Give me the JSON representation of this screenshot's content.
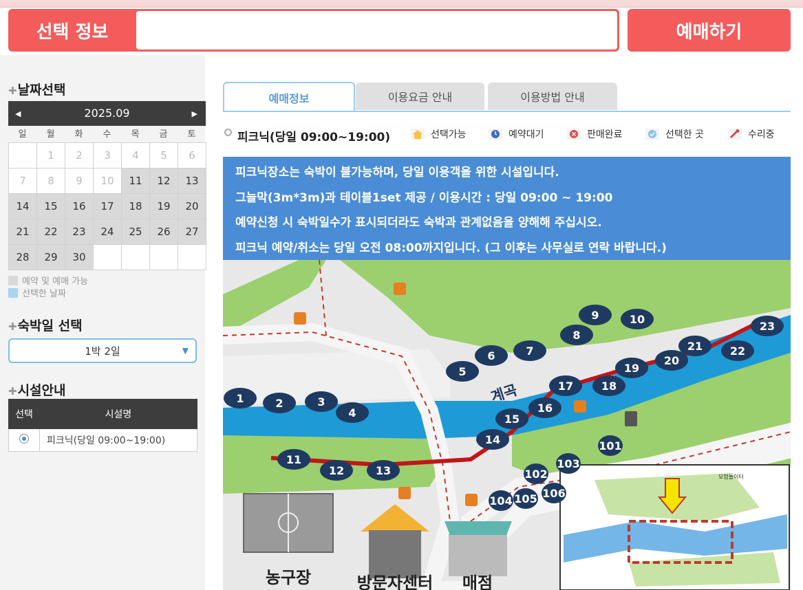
{
  "header": {
    "selection_label": "선택 정보",
    "selection_value": "",
    "book_button": "예매하기"
  },
  "calendar": {
    "section_title": "날짜선택",
    "month": "2025.09",
    "prev_icon": "triangle-left-icon",
    "next_icon": "triangle-right-icon",
    "weekdays": [
      "일",
      "월",
      "화",
      "수",
      "목",
      "금",
      "토"
    ],
    "days": [
      {
        "d": "",
        "s": "empty"
      },
      {
        "d": "1",
        "s": "past"
      },
      {
        "d": "2",
        "s": "past"
      },
      {
        "d": "3",
        "s": "past"
      },
      {
        "d": "4",
        "s": "past"
      },
      {
        "d": "5",
        "s": "past"
      },
      {
        "d": "6",
        "s": "past"
      },
      {
        "d": "7",
        "s": "past"
      },
      {
        "d": "8",
        "s": "past"
      },
      {
        "d": "9",
        "s": "past"
      },
      {
        "d": "10",
        "s": "past"
      },
      {
        "d": "11",
        "s": "avail"
      },
      {
        "d": "12",
        "s": "avail"
      },
      {
        "d": "13",
        "s": "avail"
      },
      {
        "d": "14",
        "s": "avail"
      },
      {
        "d": "15",
        "s": "avail"
      },
      {
        "d": "16",
        "s": "avail"
      },
      {
        "d": "17",
        "s": "avail"
      },
      {
        "d": "18",
        "s": "avail"
      },
      {
        "d": "19",
        "s": "avail"
      },
      {
        "d": "20",
        "s": "avail"
      },
      {
        "d": "21",
        "s": "avail"
      },
      {
        "d": "22",
        "s": "avail"
      },
      {
        "d": "23",
        "s": "avail"
      },
      {
        "d": "24",
        "s": "avail"
      },
      {
        "d": "25",
        "s": "avail"
      },
      {
        "d": "26",
        "s": "avail"
      },
      {
        "d": "27",
        "s": "avail"
      },
      {
        "d": "28",
        "s": "avail"
      },
      {
        "d": "29",
        "s": "avail"
      },
      {
        "d": "30",
        "s": "avail"
      },
      {
        "d": "",
        "s": "empty"
      },
      {
        "d": "",
        "s": "empty"
      },
      {
        "d": "",
        "s": "empty"
      },
      {
        "d": "",
        "s": "empty"
      }
    ],
    "legend_available": "예약 및 예매 가능",
    "legend_selected": "선택한 날짜",
    "colors": {
      "available": "#d9d9d9",
      "selected": "#a9d4f5"
    }
  },
  "stay": {
    "section_title": "숙박일 선택",
    "selected": "1박 2일",
    "caret_icon": "caret-down-icon"
  },
  "facility": {
    "section_title": "시설안내",
    "col_select": "선택",
    "col_name": "시설명",
    "row_name": "피크닉(당일 09:00~19:00)"
  },
  "tabs": [
    "예매정보",
    "이용요금 안내",
    "이용방법 안내"
  ],
  "main": {
    "facility_title": "피크닉(당일 09:00~19:00)",
    "legend": [
      {
        "label": "선택가능",
        "icon": "house-icon"
      },
      {
        "label": "예약대기",
        "icon": "clock-icon"
      },
      {
        "label": "판매완료",
        "icon": "sold-out-x-icon"
      },
      {
        "label": "선택한 곳",
        "icon": "selected-check-icon"
      },
      {
        "label": "수리중",
        "icon": "wrench-icon"
      }
    ],
    "notice": [
      "피크닉장소는 숙박이 불가능하며, 당일 이용객을 위한 시설입니다.",
      "그늘막(3m*3m)과 테이블1set 제공 / 이용시간 : 당일 09:00 ~ 19:00",
      "예약신청 시 숙박일수가 표시되더라도 숙박과 관계없음을 양해해 주십시오.",
      "피크닉 예약/취소는 당일 오전 08:00까지입니다. (그 이후는 사무실로 연락 바랍니다.)"
    ]
  },
  "map": {
    "stream_label": "계곡",
    "sites": [
      "1",
      "2",
      "3",
      "4",
      "5",
      "6",
      "7",
      "8",
      "9",
      "10",
      "11",
      "12",
      "13",
      "14",
      "15",
      "16",
      "17",
      "18",
      "19",
      "20",
      "21",
      "22",
      "23"
    ],
    "lower_sites": [
      "101",
      "102",
      "103",
      "104",
      "105",
      "106"
    ],
    "buildings": {
      "court": "농구장",
      "visitor_center": "방문자센터",
      "store": "매점"
    },
    "inset_label": "모험놀이터",
    "colors": {
      "stream": "#1e9ad6",
      "grass": "#9ccf6e",
      "site": "#1f3a60",
      "path": "#c0392b"
    }
  }
}
